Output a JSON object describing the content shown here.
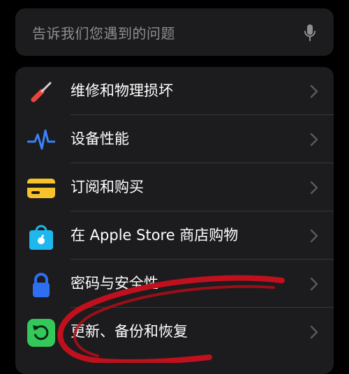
{
  "search": {
    "placeholder": "告诉我们您遇到的问题",
    "icon": "microphone-icon"
  },
  "menu": {
    "items": [
      {
        "label": "维修和物理损坏",
        "icon": "screwdriver-icon"
      },
      {
        "label": "设备性能",
        "icon": "heartbeat-icon"
      },
      {
        "label": "订阅和购买",
        "icon": "credit-card-icon"
      },
      {
        "label": "在 Apple Store 商店购物",
        "icon": "shopping-bag-icon"
      },
      {
        "label": "密码与安全性",
        "icon": "lock-icon"
      },
      {
        "label": "更新、备份和恢复",
        "icon": "restore-icon"
      }
    ]
  },
  "colors": {
    "background": "#000000",
    "card": "#1c1c1e",
    "placeholder": "#8e8e93",
    "separator": "#38383a",
    "annotation": "#c0101e"
  }
}
